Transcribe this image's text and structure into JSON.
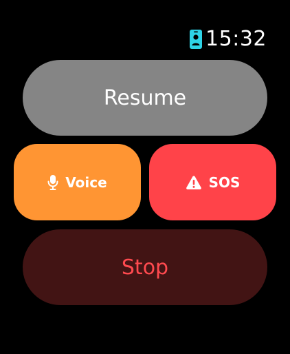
{
  "status_bar": {
    "time": "15:32",
    "badge_icon": "person-badge-icon",
    "badge_color": "#2ed3e6"
  },
  "controls": {
    "resume": {
      "label": "Resume",
      "background": "#858585",
      "text_color": "#ffffff"
    },
    "voice": {
      "label": "Voice",
      "icon": "microphone-icon",
      "background": "#ff9533",
      "text_color": "#ffffff"
    },
    "sos": {
      "label": "SOS",
      "icon": "warning-triangle-icon",
      "background": "#ff4349",
      "text_color": "#ffffff"
    },
    "stop": {
      "label": "Stop",
      "background": "#421414",
      "text_color": "#ff4a4f"
    }
  }
}
